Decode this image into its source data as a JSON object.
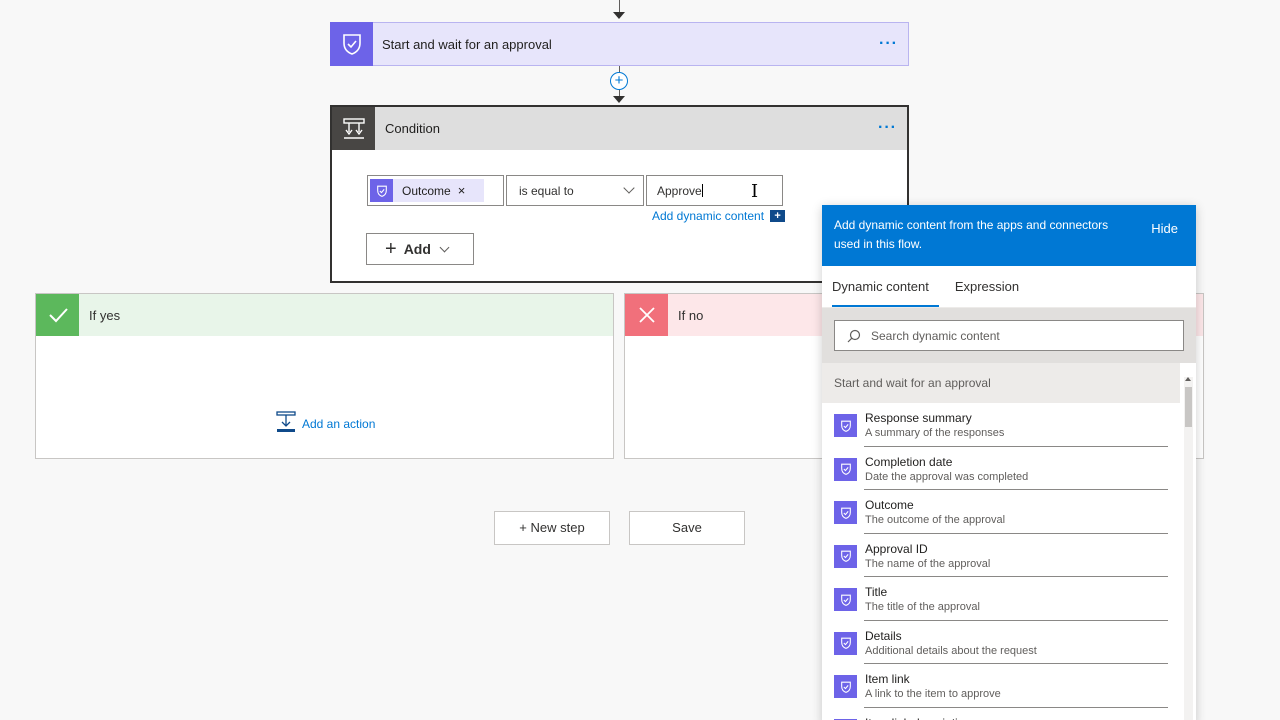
{
  "approval_step": {
    "title": "Start and wait for an approval",
    "menu": "···"
  },
  "condition": {
    "title": "Condition",
    "menu": "···",
    "token": {
      "label": "Outcome",
      "remove": "×"
    },
    "operator": "is equal to",
    "value": "Approve",
    "add_dynamic_label": "Add dynamic content",
    "add_button_label": "Add"
  },
  "branches": {
    "yes": {
      "label": "If yes",
      "add_action": "Add an action"
    },
    "no": {
      "label": "If no"
    }
  },
  "footer": {
    "new_step": "+ New step",
    "save": "Save"
  },
  "dynamic_panel": {
    "header": "Add dynamic content from the apps and connectors used in this flow.",
    "hide": "Hide",
    "tabs": [
      "Dynamic content",
      "Expression"
    ],
    "search_placeholder": "Search dynamic content",
    "group_title": "Start and wait for an approval",
    "items": [
      {
        "name": "Response summary",
        "desc": "A summary of the responses"
      },
      {
        "name": "Completion date",
        "desc": "Date the approval was completed"
      },
      {
        "name": "Outcome",
        "desc": "The outcome of the approval"
      },
      {
        "name": "Approval ID",
        "desc": "The name of the approval"
      },
      {
        "name": "Title",
        "desc": "The title of the approval"
      },
      {
        "name": "Details",
        "desc": "Additional details about the request"
      },
      {
        "name": "Item link",
        "desc": "A link to the item to approve"
      },
      {
        "name": "Item link description",
        "desc": ""
      }
    ]
  },
  "colors": {
    "accent": "#0078d4",
    "approval": "#6d63e8",
    "yes": "#5cb85c",
    "no": "#f1707b"
  }
}
